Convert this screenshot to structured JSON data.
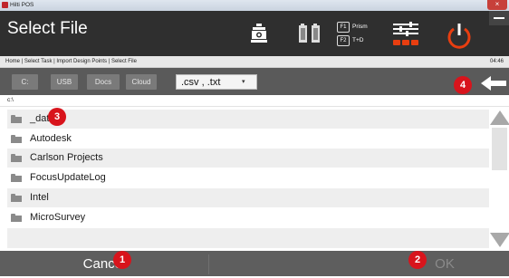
{
  "window": {
    "title": "Hilti POS",
    "close_symbol": "×"
  },
  "header": {
    "title": "Select File",
    "f1_key": "F1",
    "f1_label": "Prism",
    "f2_key": "F2",
    "f2_label": "T+D",
    "icons": [
      "instrument-icon",
      "battery-icon",
      "function-keys-icon",
      "settings-sliders-icon",
      "power-icon"
    ]
  },
  "breadcrumb": {
    "text": "Home | Select Task | Import Design Points | Select File",
    "time": "04:46"
  },
  "toolbar": {
    "drives": [
      "C:",
      "USB",
      "Docs",
      "Cloud"
    ],
    "filter": {
      "value": ".csv , .txt",
      "arrow": "▾"
    }
  },
  "path": "c:\\",
  "files": [
    "_data",
    "Autodesk",
    "Carlson Projects",
    "FocusUpdateLog",
    "Intel",
    "MicroSurvey"
  ],
  "footer": {
    "cancel": "Cancel",
    "ok": "OK"
  },
  "callouts": {
    "one": "1",
    "two": "2",
    "three": "3",
    "four": "4"
  },
  "colors": {
    "header_bg": "#2f2f2f",
    "toolbar_bg": "#5a5a5a",
    "footer_bg": "#5e5e5e",
    "badge": "#d8141c",
    "accent_orange": "#e83e10"
  }
}
